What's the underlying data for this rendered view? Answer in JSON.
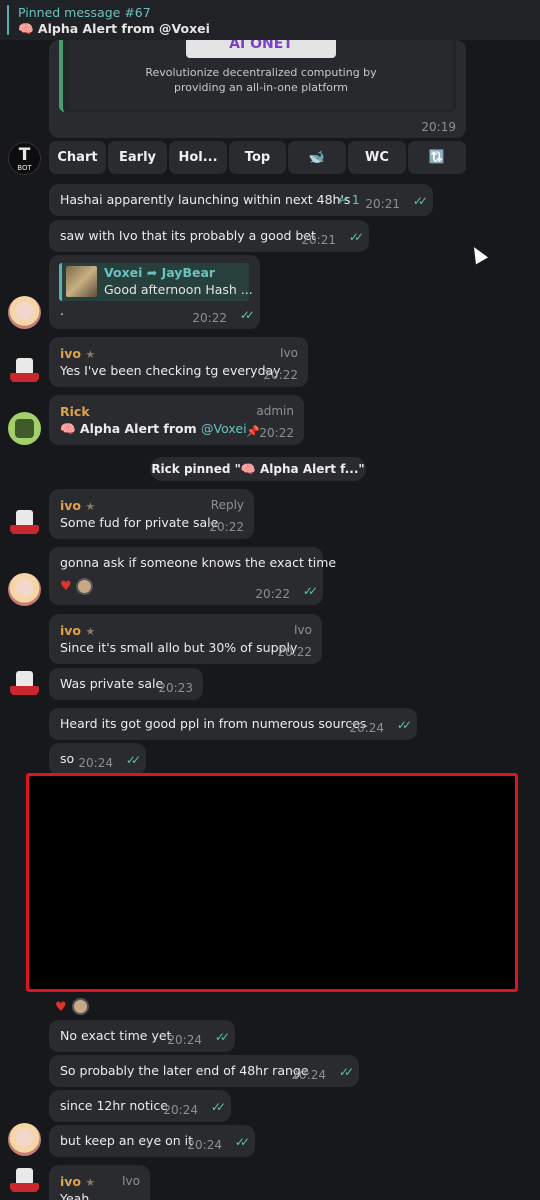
{
  "pinned": {
    "title": "Pinned message #67",
    "text": "🧠 Alpha Alert from @Voxei"
  },
  "preview": {
    "logo_text": "AI ONET",
    "line1": "Revolutionize decentralized computing by",
    "line2": "providing an all-in-one platform",
    "time": "20:19"
  },
  "bot_avatar": {
    "letter": "T",
    "label": "BOT"
  },
  "keyboard": [
    "Chart",
    "Early",
    "Hol...",
    "Top",
    "🐋",
    "WC",
    "🔃"
  ],
  "messages": {
    "m1": {
      "text": "Hashai apparently launching within next 48h's",
      "replies": "1",
      "time": "20:21"
    },
    "m2": {
      "text": "saw with Ivo that its probably a good bet",
      "time": "20:21"
    },
    "m3": {
      "reply_author": "Voxei",
      "reply_to": "JayBear",
      "reply_text": "Good afternoon Hash ...",
      "text": ".",
      "time": "20:22"
    },
    "m4": {
      "sender": "ivo",
      "role": "Ivo",
      "text": "Yes I've been checking tg everyday",
      "time": "20:22"
    },
    "m5": {
      "sender": "Rick",
      "role": "admin",
      "text_prefix": "🧠 Alpha Alert from",
      "text_link": "@Voxei",
      "time": "20:22"
    },
    "service": "Rick pinned \"🧠 Alpha Alert f...\"",
    "m6": {
      "sender": "ivo",
      "role": "Reply",
      "text": "Some fud for private sale",
      "time": "20:22"
    },
    "m7": {
      "text": "gonna ask if someone knows the exact time",
      "time": "20:22"
    },
    "m8": {
      "sender": "ivo",
      "role": "Ivo",
      "text": "Since it's small allo but 30% of supply",
      "time": "20:22"
    },
    "m9": {
      "text": "Was private sale",
      "time": "20:23"
    },
    "m10": {
      "text": "Heard its got good ppl in from numerous sources",
      "time": "20:24"
    },
    "m11": {
      "text": "so",
      "time": "20:24"
    },
    "m12": {
      "text": "No exact time yet",
      "time": "20:24"
    },
    "m13": {
      "text": "So probably the later end of 48hr range",
      "time": "20:24"
    },
    "m14": {
      "text": "since 12hr notice",
      "time": "20:24"
    },
    "m15": {
      "text": "but keep an eye on it",
      "time": "20:24"
    },
    "m16": {
      "sender": "ivo",
      "role": "Ivo",
      "text": "Yeah"
    }
  },
  "colors": {
    "accent": "#56b3b4",
    "sender_ivo": "#e0a24a",
    "sender_rick": "#e0a24a",
    "link": "#6ac3c0",
    "ticks": "#5fc1a6",
    "redact_border": "#e0141c"
  }
}
